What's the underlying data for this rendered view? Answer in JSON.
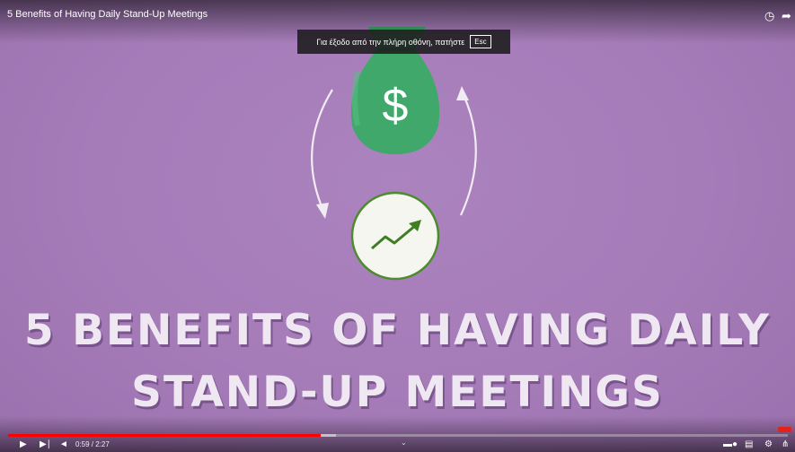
{
  "video": {
    "title": "5 Benefits of Having Daily Stand-Up Meetings",
    "headline_line1": "5 BENEFITS OF HAVING DAILY",
    "headline_line2": "STAND-UP MEETINGS",
    "money_symbol": "$"
  },
  "overlay": {
    "exit_fullscreen_text": "Για έξοδο από την πλήρη οθόνη, πατήστε",
    "esc_key": "Esc"
  },
  "player": {
    "current_time": "0:59",
    "duration": "2:27",
    "time_text": "0:59 / 2:27",
    "played_fraction": 0.401,
    "loaded_fraction": 0.42
  },
  "icons": {
    "top_right": [
      "watch-later-icon",
      "share-icon"
    ],
    "controls_left": [
      "play-icon",
      "next-icon",
      "volume-icon"
    ],
    "controls_right": [
      "autoplay-toggle-icon",
      "subtitles-icon",
      "settings-icon",
      "exit-fullscreen-icon"
    ]
  },
  "colors": {
    "background": "#a57bb8",
    "money_bag": "#3fa86a",
    "progress_red": "#ff0000",
    "headline_text": "#efe8f3",
    "chart_line": "#3e7f24"
  }
}
